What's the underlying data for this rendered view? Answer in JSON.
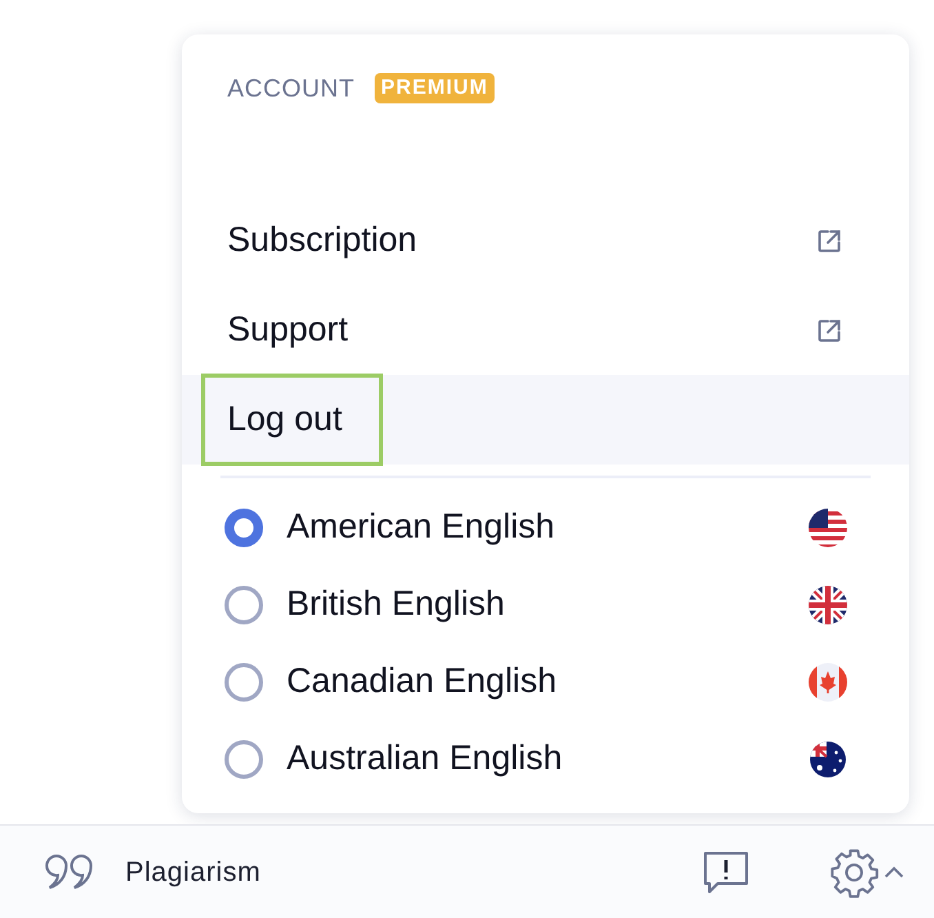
{
  "menu": {
    "header": {
      "label": "ACCOUNT",
      "badge": "PREMIUM"
    },
    "items": [
      {
        "label": "Subscription",
        "external": true,
        "highlighted": false,
        "focused": false
      },
      {
        "label": "Support",
        "external": true,
        "highlighted": false,
        "focused": false
      },
      {
        "label": "Log out",
        "external": false,
        "highlighted": true,
        "focused": true
      }
    ],
    "languages": [
      {
        "label": "American English",
        "selected": true
      },
      {
        "label": "British English",
        "selected": false
      },
      {
        "label": "Canadian English",
        "selected": false
      },
      {
        "label": "Australian English",
        "selected": false
      }
    ]
  },
  "bottom_bar": {
    "label": "Plagiarism"
  }
}
